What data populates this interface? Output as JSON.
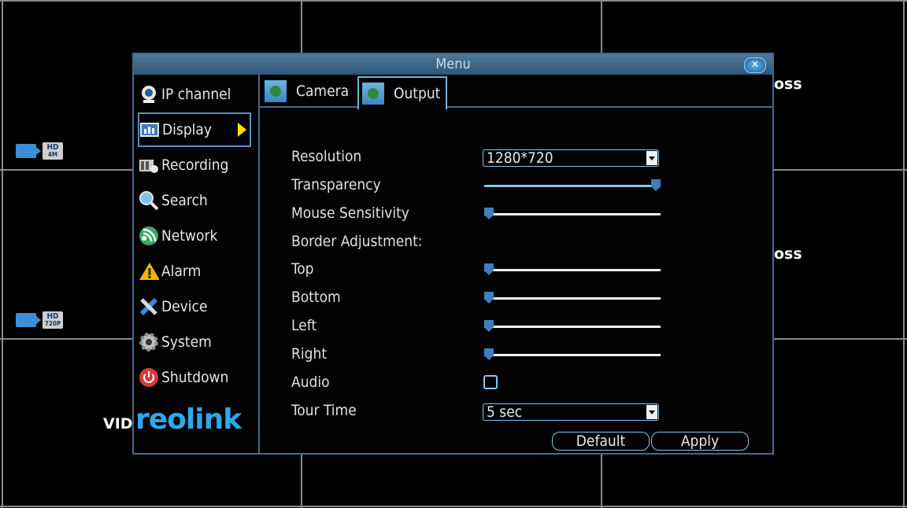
{
  "camera_grid": {
    "overlay_top": "oss",
    "overlay_mid": "oss",
    "overlay_vid": "VID",
    "badge1": {
      "hd": "HD",
      "res": "4M"
    },
    "badge2": {
      "hd": "HD",
      "res": "720P"
    }
  },
  "dialog": {
    "title": "Menu",
    "close": "✕"
  },
  "sidebar": {
    "items": [
      {
        "label": "IP channel",
        "icon": "webcam-icon"
      },
      {
        "label": "Display",
        "icon": "display-icon"
      },
      {
        "label": "Recording",
        "icon": "recording-icon"
      },
      {
        "label": "Search",
        "icon": "search-icon"
      },
      {
        "label": "Network",
        "icon": "network-icon"
      },
      {
        "label": "Alarm",
        "icon": "warning-icon"
      },
      {
        "label": "Device",
        "icon": "tools-icon"
      },
      {
        "label": "System",
        "icon": "gear-icon"
      },
      {
        "label": "Shutdown",
        "icon": "power-icon"
      }
    ],
    "logo": "reolink"
  },
  "tabs": [
    {
      "label": "Camera"
    },
    {
      "label": "Output"
    }
  ],
  "form": {
    "resolution": {
      "label": "Resolution",
      "value": "1280*720"
    },
    "transparency": {
      "label": "Transparency",
      "level": 1.0
    },
    "mouse_sensitivity": {
      "label": "Mouse Sensitivity",
      "level": 0.0
    },
    "border_adjustment": {
      "label": "Border Adjustment:"
    },
    "top": {
      "label": "Top",
      "level": 0.0
    },
    "bottom": {
      "label": "Bottom",
      "level": 0.0
    },
    "left": {
      "label": "Left",
      "level": 0.0
    },
    "right": {
      "label": "Right",
      "level": 0.0
    },
    "audio": {
      "label": "Audio",
      "checked": false
    },
    "tour_time": {
      "label": "Tour Time",
      "value": "5 sec"
    }
  },
  "buttons": {
    "default": "Default",
    "apply": "Apply"
  },
  "colors": {
    "accent": "#8cc4e6",
    "titlebar": "#3f6a8c",
    "slider_thumb": "#3d7fc0",
    "active_arrow": "#ffe400"
  }
}
